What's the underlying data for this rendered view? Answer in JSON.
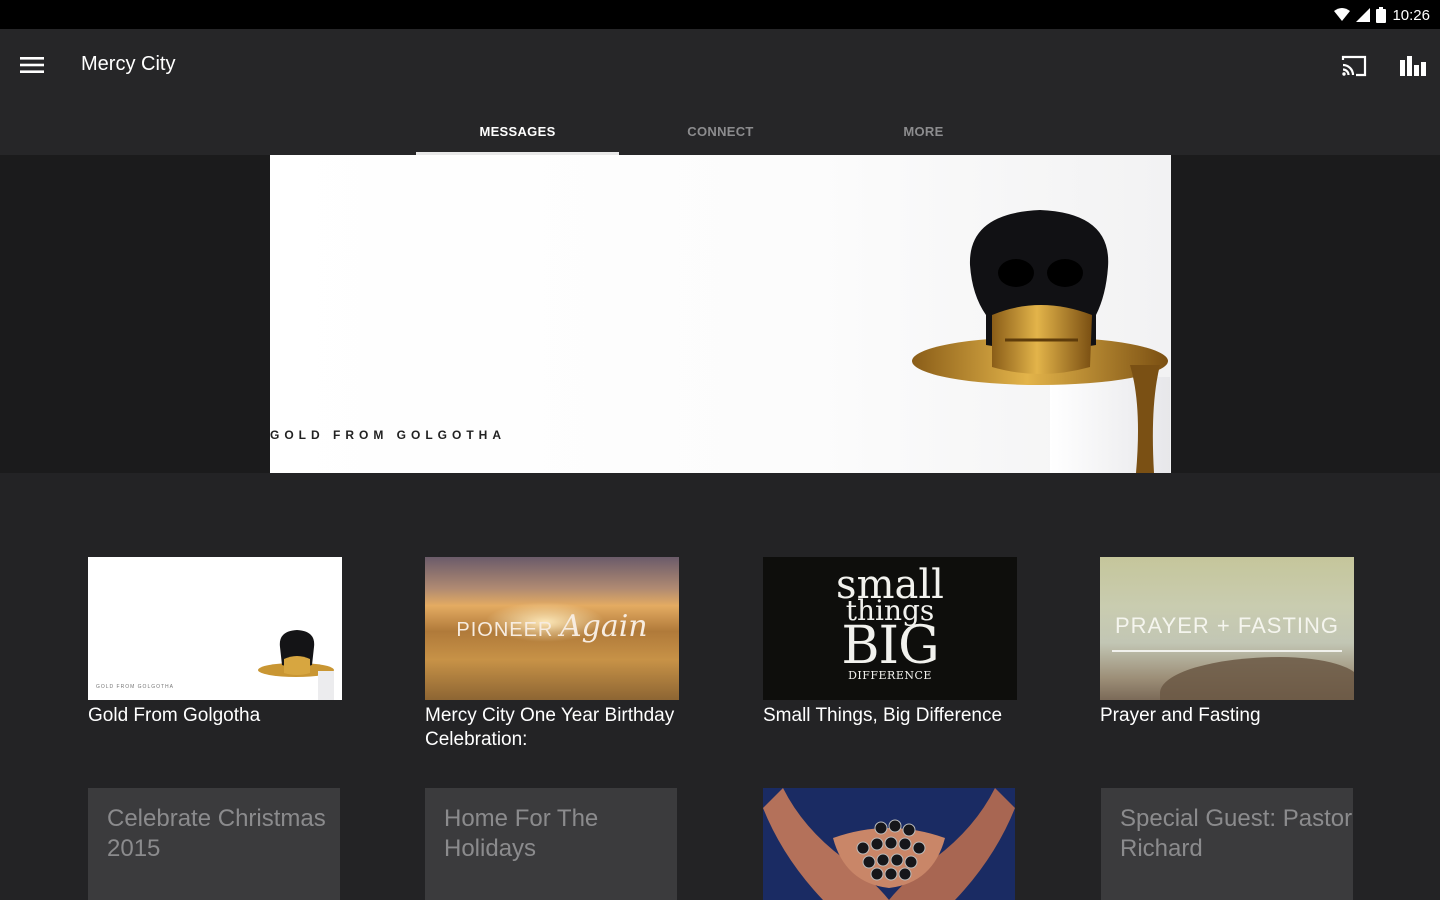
{
  "status_bar": {
    "time": "10:26"
  },
  "app_bar": {
    "title": "Mercy City"
  },
  "tabs": [
    {
      "label": "MESSAGES",
      "active": true
    },
    {
      "label": "CONNECT",
      "active": false
    },
    {
      "label": "MORE",
      "active": false
    }
  ],
  "hero": {
    "caption": "GOLD FROM GOLGOTHA"
  },
  "series": [
    {
      "title": "Gold From Golgotha",
      "thumb_text": "GOLD FROM GOLGOTHA"
    },
    {
      "title": "Mercy City One Year Birthday Celebration:",
      "thumb_text_1": "PIONEER",
      "thumb_text_2": "Again"
    },
    {
      "title": "Small Things, Big Difference",
      "thumb_lines": [
        "small",
        "things",
        "BIG",
        "DIFFERENCE"
      ]
    },
    {
      "title": "Prayer and Fasting",
      "thumb_text": "PRAYER + FASTING"
    }
  ],
  "placeholders": [
    {
      "title": "Celebrate Christmas 2015"
    },
    {
      "title": "Home For The Holidays"
    },
    {
      "title": ""
    },
    {
      "title": "Special Guest: Pastor Richard"
    }
  ],
  "colors": {
    "background": "#232325",
    "app_bar": "#262628",
    "hero_band": "#1b1b1c",
    "placeholder": "#3b3b3d",
    "status_bar": "#000000"
  }
}
